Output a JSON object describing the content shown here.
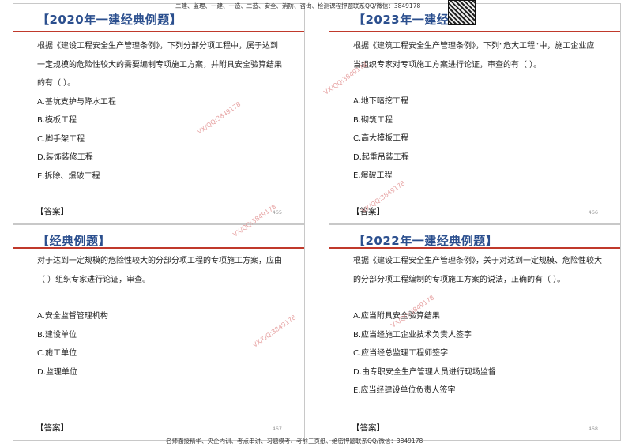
{
  "top_banner": "二建、监理、一建、一造、二造、安全、消防、咨询、检测课程押题联系QQ/微信：3849178",
  "bottom_banner": "名师面授精华、央企内训、考点串讲、习题模考、考前三页纸、绝密押题联系QQ/微信：3849178",
  "watermark": "VX/QQ:3849178",
  "answer_label": "【答案】",
  "panels": [
    {
      "title": "【2020年一建经典例题】",
      "question": "根据《建设工程安全生产管理条例》，下列分部分项工程中，属于达到一定规模的危险性较大的需要编制专项施工方案，并附具安全验算结果的有（ ）。",
      "options": [
        "A.基坑支护与降水工程",
        "B.模板工程",
        "C.脚手架工程",
        "D.装饰装修工程",
        "E.拆除、爆破工程"
      ],
      "page": "465"
    },
    {
      "title": "【2023年一建经典",
      "question": "根据《建筑工程安全生产管理条例》，下列“危大工程”中，施工企业应当组织专家对专项施工方案进行论证，审查的有（ ）。",
      "options": [
        "A.地下暗挖工程",
        "B.砌筑工程",
        "C.高大模板工程",
        "D.起重吊装工程",
        "E.爆破工程"
      ],
      "page": "466"
    },
    {
      "title": "【经典例题】",
      "question": "对于达到一定规模的危险性较大的分部分项工程的专项施工方案，应由（ ）组织专家进行论证，审查。",
      "options": [
        "A.安全监督管理机构",
        "B.建设单位",
        "C.施工单位",
        "D.监理单位"
      ],
      "page": "467"
    },
    {
      "title": "【2022年一建经典例题】",
      "question": "根据《建设工程安全生产管理条例》，关于对达到一定规模、危险性较大的分部分项工程编制的专项施工方案的说法，正确的有（ ）。",
      "options": [
        "A.应当附具安全验算结果",
        "B.应当经施工企业技术负责人签字",
        "C.应当经总监理工程师签字",
        "D.由专职安全生产管理人员进行现场监督",
        "E.应当经建设单位负责人签字"
      ],
      "page": "468"
    }
  ]
}
